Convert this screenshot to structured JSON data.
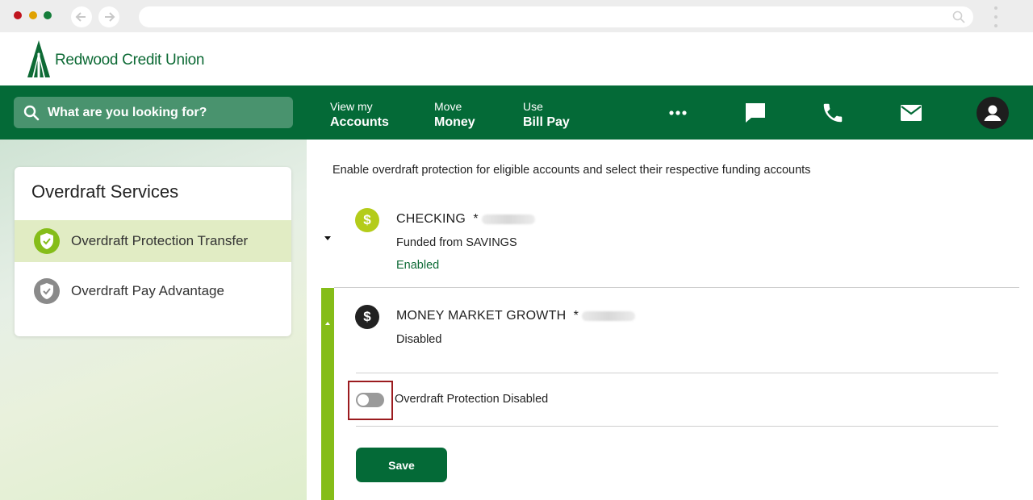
{
  "browser": {
    "dots": [
      "red",
      "yellow",
      "green"
    ],
    "url": ""
  },
  "brand": {
    "name": "Redwood Credit Union",
    "color": "#0d6a35"
  },
  "navbar": {
    "search_placeholder": "What are you looking for?",
    "items": [
      {
        "small": "View my",
        "large": "Accounts"
      },
      {
        "small": "Move",
        "large": "Money"
      },
      {
        "small": "Use",
        "large": "Bill Pay"
      }
    ],
    "icons": [
      "more-icon",
      "chat-icon",
      "phone-icon",
      "mail-icon",
      "profile-icon"
    ],
    "color": "#046a37"
  },
  "sidebar": {
    "title": "Overdraft Services",
    "items": [
      {
        "label": "Overdraft Protection Transfer",
        "active": true
      },
      {
        "label": "Overdraft Pay Advantage",
        "active": false
      }
    ]
  },
  "main": {
    "intro": "Enable overdraft protection for eligible accounts and select their respective funding accounts",
    "accounts": [
      {
        "name": "CHECKING",
        "mask": "*",
        "funded": "Funded from SAVINGS",
        "status": "Enabled",
        "expanded": false
      },
      {
        "name": "MONEY MARKET GROWTH",
        "mask": "*",
        "status": "Disabled",
        "expanded": true
      }
    ],
    "toggle": {
      "label": "Overdraft Protection Disabled",
      "on": false
    },
    "save_label": "Save"
  }
}
